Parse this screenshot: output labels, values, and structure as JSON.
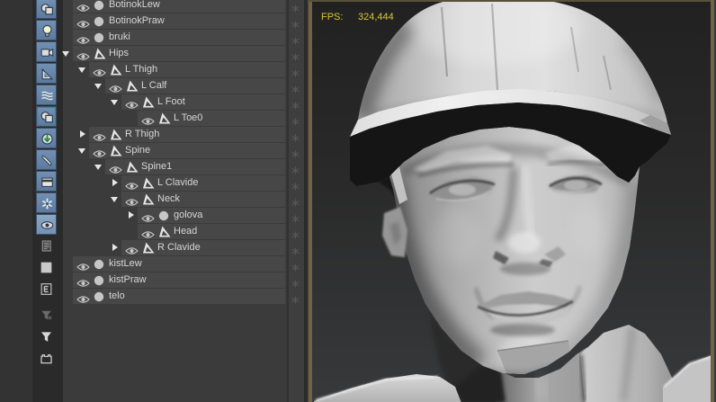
{
  "viewport": {
    "fps_label": "FPS:",
    "fps_value": "324,444",
    "fps_color": "#d9c63e",
    "border_color": "#6f6345",
    "model": "low-poly man wearing hard hat"
  },
  "toolbar": {
    "buttons": [
      {
        "name": "display-geometry",
        "glyph": "geom",
        "active": true
      },
      {
        "name": "display-lights",
        "glyph": "bulb",
        "active": true
      },
      {
        "name": "display-cameras",
        "glyph": "camera",
        "active": true
      },
      {
        "name": "display-helpers",
        "glyph": "helper",
        "active": true
      },
      {
        "name": "display-spacewarps",
        "glyph": "waves",
        "active": true
      },
      {
        "name": "display-groups",
        "glyph": "groups",
        "active": true
      },
      {
        "name": "display-xrefs",
        "glyph": "xref",
        "active": true
      },
      {
        "name": "display-bones",
        "glyph": "bone",
        "active": true
      },
      {
        "name": "display-containers",
        "glyph": "container",
        "active": true
      },
      {
        "name": "display-frozen",
        "glyph": "frozen",
        "active": true
      },
      {
        "name": "display-hidden",
        "glyph": "eye",
        "active": true,
        "lighter": true
      },
      {
        "name": "display-materials",
        "glyph": "list",
        "active": false
      },
      {
        "name": "display-swatch",
        "glyph": "swatch",
        "active": false
      },
      {
        "name": "edit-properties",
        "glyph": "edit",
        "active": false
      },
      {
        "name": "filter-combinations",
        "glyph": "filterb",
        "active": false
      },
      {
        "name": "filter",
        "glyph": "funnel",
        "active": false
      },
      {
        "name": "container-explorer",
        "glyph": "basket",
        "active": false
      }
    ]
  },
  "tree": {
    "rows": [
      {
        "label": "BotinokLew",
        "level": 0,
        "icon": "circle",
        "expand": null
      },
      {
        "label": "BotinokPraw",
        "level": 0,
        "icon": "circle",
        "expand": null
      },
      {
        "label": "bruki",
        "level": 0,
        "icon": "circle",
        "expand": null
      },
      {
        "label": "Hips",
        "level": 0,
        "icon": "bone",
        "expand": "open"
      },
      {
        "label": "L Thigh",
        "level": 1,
        "icon": "bone",
        "expand": "open"
      },
      {
        "label": "L Calf",
        "level": 2,
        "icon": "bone",
        "expand": "open"
      },
      {
        "label": "L Foot",
        "level": 3,
        "icon": "bone",
        "expand": "open"
      },
      {
        "label": "L Toe0",
        "level": 4,
        "icon": "bone",
        "expand": null
      },
      {
        "label": "R Thigh",
        "level": 1,
        "icon": "bone",
        "expand": "closed"
      },
      {
        "label": "Spine",
        "level": 1,
        "icon": "bone",
        "expand": "open"
      },
      {
        "label": "Spine1",
        "level": 2,
        "icon": "bone",
        "expand": "open"
      },
      {
        "label": "L Clavide",
        "level": 3,
        "icon": "bone",
        "expand": "closed"
      },
      {
        "label": "Neck",
        "level": 3,
        "icon": "bone",
        "expand": "open"
      },
      {
        "label": "golova",
        "level": 4,
        "icon": "circle",
        "expand": "closed"
      },
      {
        "label": "Head",
        "level": 4,
        "icon": "bone",
        "expand": null
      },
      {
        "label": "R Clavide",
        "level": 3,
        "icon": "bone",
        "expand": "closed"
      },
      {
        "label": "kistLew",
        "level": 0,
        "icon": "circle",
        "expand": null
      },
      {
        "label": "kistPraw",
        "level": 0,
        "icon": "circle",
        "expand": null
      },
      {
        "label": "telo",
        "level": 0,
        "icon": "circle",
        "expand": null
      }
    ]
  }
}
